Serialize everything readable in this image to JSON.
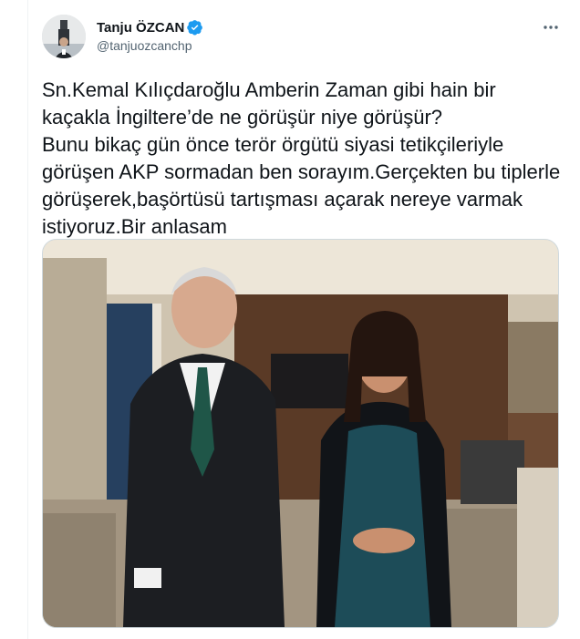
{
  "tweet": {
    "author_name": "Tanju ÖZCAN",
    "author_handle": "@tanjuozcanchp",
    "verified_icon": "verified-badge-icon",
    "more_icon": "more-options-icon",
    "text": "Sn.Kemal Kılıçdaroğlu Amberin Zaman gibi hain bir kaçakla İngiltere’de ne görüşür niye görüşür?\nBunu bikaç gün önce terör örgütü siyasi tetikçileriyle görüşen AKP sormadan ben sorayım.Gerçekten bu tiplerle görüşerek,başörtüsü tartışması açarak nereye varmak istiyoruz.Bir anlasam"
  },
  "colors": {
    "verified": "#1d9bf0",
    "text": "#0f1419",
    "secondary": "#536471",
    "border": "#cfd9de"
  }
}
